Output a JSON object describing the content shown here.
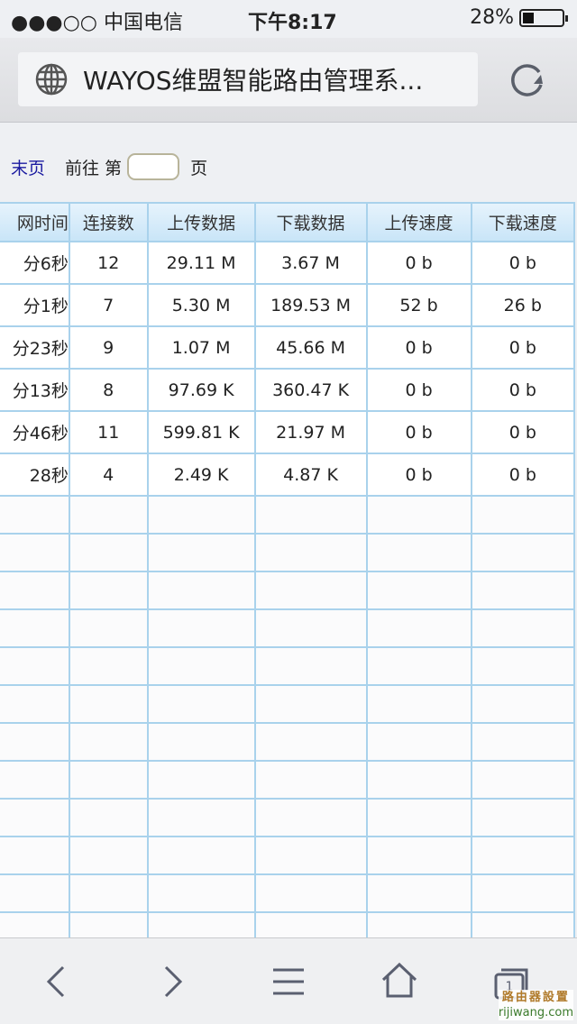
{
  "status": {
    "carrier": "●●●○○ 中国电信",
    "time": "下午8:17",
    "battery": "28%",
    "battery_level": 0.28
  },
  "browser": {
    "title": "WAYOS维盟智能路由管理系...",
    "watermark_cn": "路由器設置",
    "watermark_url": "rijiwang.com",
    "tab_count": "1"
  },
  "pager": {
    "last": "末页",
    "goto": "前往 第",
    "page_unit": "页",
    "page_value": ""
  },
  "table": {
    "headers": [
      "网时间",
      "连接数",
      "上传数据",
      "下载数据",
      "上传速度",
      "下载速度"
    ],
    "rows": [
      [
        "分6秒",
        "12",
        "29.11 M",
        "3.67 M",
        "0 b",
        "0 b"
      ],
      [
        "分1秒",
        "7",
        "5.30 M",
        "189.53 M",
        "52 b",
        "26 b"
      ],
      [
        "分23秒",
        "9",
        "1.07 M",
        "45.66 M",
        "0 b",
        "0 b"
      ],
      [
        "分13秒",
        "8",
        "97.69 K",
        "360.47 K",
        "0 b",
        "0 b"
      ],
      [
        "分46秒",
        "11",
        "599.81 K",
        "21.97 M",
        "0 b",
        "0 b"
      ],
      [
        "28秒",
        "4",
        "2.49 K",
        "4.87 K",
        "0 b",
        "0 b"
      ]
    ]
  }
}
